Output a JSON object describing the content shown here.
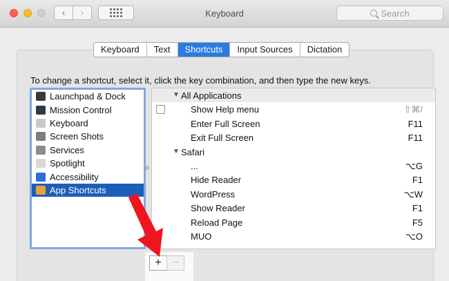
{
  "window": {
    "title": "Keyboard"
  },
  "search": {
    "placeholder": "Search"
  },
  "tabs": [
    "Keyboard",
    "Text",
    "Shortcuts",
    "Input Sources",
    "Dictation"
  ],
  "active_tab": "Shortcuts",
  "instructions": "To change a shortcut, select it, click the key combination, and then type the new keys.",
  "categories": [
    {
      "label": "Launchpad & Dock",
      "icon": "launchpad-icon",
      "color": "#3a3a3a"
    },
    {
      "label": "Mission Control",
      "icon": "mission-control-icon",
      "color": "#2f3b44"
    },
    {
      "label": "Keyboard",
      "icon": "keyboard-icon",
      "color": "#c9c9c9"
    },
    {
      "label": "Screen Shots",
      "icon": "screenshot-icon",
      "color": "#7d7d7d"
    },
    {
      "label": "Services",
      "icon": "gear-icon",
      "color": "#8c8c8c"
    },
    {
      "label": "Spotlight",
      "icon": "spotlight-icon",
      "color": "#d8d8d8"
    },
    {
      "label": "Accessibility",
      "icon": "accessibility-icon",
      "color": "#2f6fd1"
    },
    {
      "label": "App Shortcuts",
      "icon": "app-shortcuts-icon",
      "color": "#e9a13a"
    }
  ],
  "selected_category": "App Shortcuts",
  "groups": [
    {
      "label": "All Applications",
      "items": [
        {
          "name": "Show Help menu",
          "keys": "⇧⌘/",
          "dim": true,
          "checkbox": true
        },
        {
          "name": "Enter Full Screen",
          "keys": "F11"
        },
        {
          "name": "Exit Full Screen",
          "keys": "F11"
        }
      ]
    },
    {
      "label": "Safari",
      "items": [
        {
          "name": "...",
          "keys": "⌥G"
        },
        {
          "name": "Hide Reader",
          "keys": "F1"
        },
        {
          "name": "WordPress",
          "keys": "⌥W"
        },
        {
          "name": "Show Reader",
          "keys": "F1"
        },
        {
          "name": "Reload Page",
          "keys": "F5"
        },
        {
          "name": "MUO",
          "keys": "⌥O"
        }
      ]
    }
  ],
  "buttons": {
    "add": "+",
    "remove": "−"
  },
  "colors": {
    "accent": "#2b7be0",
    "selection": "#1c5fb8",
    "annotation_arrow": "#f0141e"
  }
}
